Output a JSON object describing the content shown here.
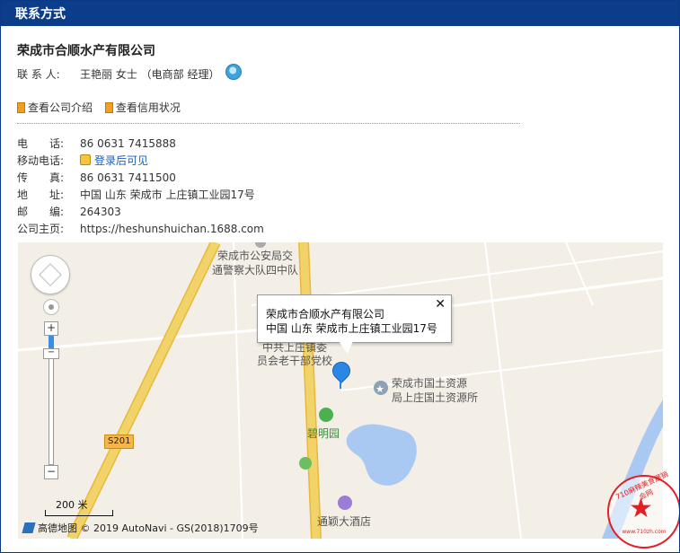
{
  "panel": {
    "title": "联系方式"
  },
  "company": {
    "name": "荣成市合顺水产有限公司"
  },
  "contact": {
    "label": "联 系 人:",
    "value": "王艳丽 女士 （电商部 经理）"
  },
  "links": [
    {
      "label": "查看公司介绍"
    },
    {
      "label": "查看信用状况"
    }
  ],
  "info": {
    "phone": {
      "label": "电　　话:",
      "value": "86 0631 7415888"
    },
    "mobile": {
      "label": "移动电话:",
      "value": "登录后可见"
    },
    "fax": {
      "label": "传　　真:",
      "value": "86 0631 7411500"
    },
    "address": {
      "label": "地　　址:",
      "value": "中国 山东 荣成市 上庄镇工业园17号"
    },
    "postcode": {
      "label": "邮　　编:",
      "value": "264303"
    },
    "homepage": {
      "label": "公司主页:",
      "value": "https://heshunshuichan.1688.com"
    }
  },
  "map": {
    "popup": {
      "line1": "荣成市合顺水产有限公司",
      "line2": "中国 山东 荣成市上庄镇工业园17号",
      "close": "✕"
    },
    "labels": {
      "police_a": "荣成市公安局交",
      "police_b": "通警察大队四中队",
      "party_a": "中共上庄镇委",
      "party_b": "员会老干部党校",
      "land_a": "荣成市国土资源",
      "land_b": "局上庄国土资源所",
      "garden": "碧明园",
      "hotel": "通颖大酒店",
      "road": "S201"
    },
    "scale": "200 米",
    "attribution": "高德地图 © 2019 AutoNavi - GS(2018)1709号",
    "zoom_in": "+",
    "zoom_out": "−"
  },
  "watermark": {
    "text": "710麻辣美食展销会网",
    "url": "www.710zh.com"
  },
  "colors": {
    "header_bg": "#0b3d8a",
    "map_bg": "#f3efe6",
    "road_main": "#f2d36a",
    "water": "#a9c9f2",
    "link": "#1a5dbe",
    "stamp": "#e31e24"
  }
}
